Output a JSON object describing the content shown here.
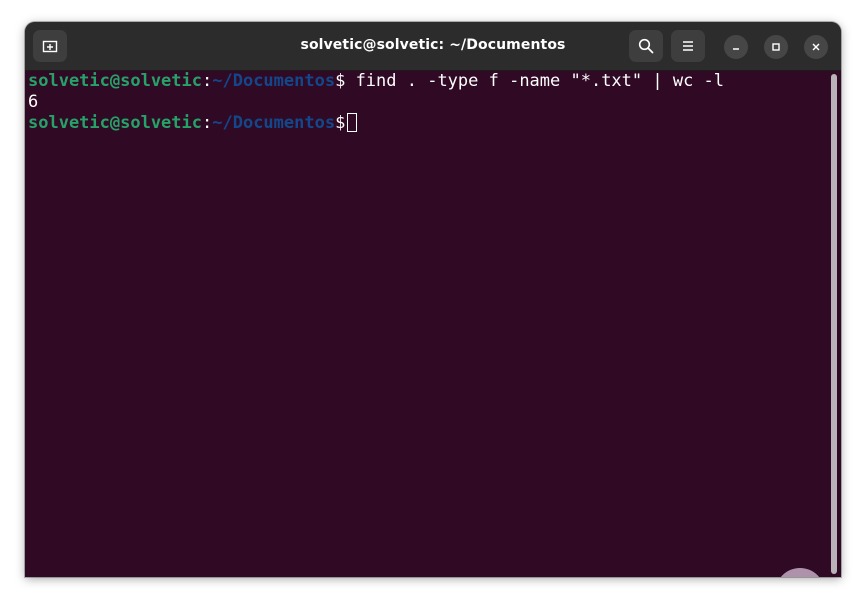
{
  "window": {
    "title": "solvetic@solvetic: ~/Documentos"
  },
  "header": {
    "new_tab_icon": "new-tab-icon",
    "search_icon": "search-icon",
    "menu_icon": "hamburger-menu-icon",
    "minimize_icon": "minimize-icon",
    "maximize_icon": "maximize-icon",
    "close_icon": "close-icon"
  },
  "terminal": {
    "lines": [
      {
        "user": "solvetic@solvetic",
        "colon": ":",
        "path": "~/Documentos",
        "prompt_symbol": "$",
        "command": " find . -type f -name \"*.txt\" | wc -l"
      },
      {
        "output": "6"
      },
      {
        "user": "solvetic@solvetic",
        "colon": ":",
        "path": "~/Documentos",
        "prompt_symbol": "$",
        "command": " "
      }
    ]
  },
  "colors": {
    "terminal_bg": "#300a24",
    "user_green": "#26a269",
    "path_blue": "#12488b",
    "titlebar_bg": "#2c2c2c"
  },
  "watermark_icon": "solvetic-logo-icon"
}
